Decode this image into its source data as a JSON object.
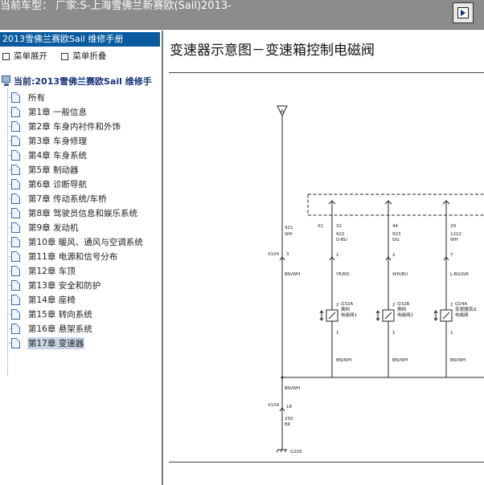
{
  "header": {
    "title": "当前车型： 厂家:S-上海雪佛兰新赛欧(Sail)2013-",
    "button_icon": "play-icon"
  },
  "sidebar": {
    "handbook": "2013雪佛兰赛欧Sail 维修手册",
    "expand_label": "菜单展开",
    "collapse_label": "菜单折叠",
    "root_label": "当前:2013雪佛兰赛欧Sail 维修手",
    "items": [
      {
        "label": "所有"
      },
      {
        "label": "第1章 一般信息"
      },
      {
        "label": "第2章 车身内衬件和外饰"
      },
      {
        "label": "第3章 车身修理"
      },
      {
        "label": "第4章 车身系统"
      },
      {
        "label": "第5章 制动器"
      },
      {
        "label": "第6章 诊断导航"
      },
      {
        "label": "第7章 传动系统/车桥"
      },
      {
        "label": "第8章 驾驶员信息和娱乐系统"
      },
      {
        "label": "第9章 发动机"
      },
      {
        "label": "第10章 暖风、通风与空调系统"
      },
      {
        "label": "第11章 电源和信号分布"
      },
      {
        "label": "第12章 车顶"
      },
      {
        "label": "第13章 安全和防护"
      },
      {
        "label": "第14章 座椅"
      },
      {
        "label": "第15章 转向系统"
      },
      {
        "label": "第16章 悬架系统"
      },
      {
        "label": "第17章 变速器",
        "selected": true
      }
    ]
  },
  "content": {
    "title": "变速器示意图－变速箱控制电磁阀",
    "diagram": {
      "supply_symbol": "A",
      "connector_x1": "X1",
      "connector_x104": "X104",
      "source_wire": "921",
      "source_color": "WH",
      "x104_pin": "3",
      "bus_color": "BN/WH",
      "branches": [
        {
          "x1_pin": "32",
          "wire": "922",
          "color": "D-BU",
          "x104_pin": "1",
          "wire_label": "YE/RD",
          "comp_id": "Q32A",
          "comp_desc1": "换档",
          "comp_desc2": "电磁阀1",
          "pin_top": "2",
          "pin_bot": "1",
          "out_color": "BN/WH"
        },
        {
          "x1_pin": "44",
          "wire": "923",
          "color": "OG",
          "x104_pin": "2",
          "wire_label": "WH/BU",
          "comp_id": "Q32B",
          "comp_desc1": "换档",
          "comp_desc2": "电磁阀2",
          "pin_top": "2",
          "pin_bot": "1",
          "out_color": "BN/WH"
        },
        {
          "x1_pin": "29",
          "wire": "1222",
          "color": "WH",
          "x104_pin": "7",
          "wire_label": "L-BU/GN",
          "comp_id": "Q24A",
          "comp_desc1": "变速器锁止",
          "comp_desc2": "电磁阀",
          "pin_top": "2",
          "pin_bot": "1",
          "out_color": "BN/WH"
        }
      ],
      "ground_wire_color": "BN/WH",
      "ground_pin": "18",
      "ground_wire": "250",
      "ground_color": "BK",
      "ground_id": "G105"
    }
  }
}
